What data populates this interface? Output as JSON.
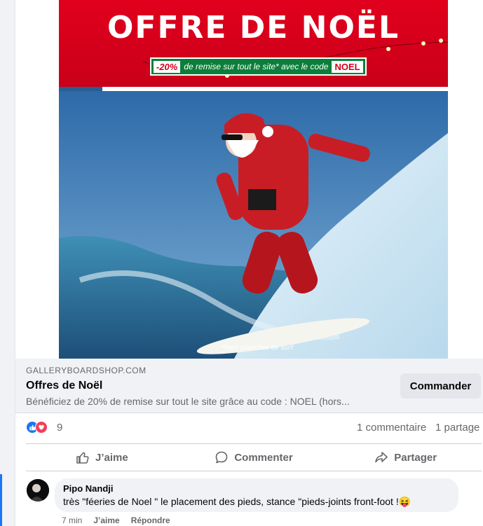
{
  "banner": {
    "title": "OFFRE DE NOËL",
    "discount": "-20%",
    "promo_text": "de remise sur tout le site* avec le code",
    "code": "NOEL",
    "footnote": "*hors planches de surf"
  },
  "link_preview": {
    "domain": "GALLERYBOARDSHOP.COM",
    "title": "Offres de Noël",
    "description": "Bénéficiez de 20% de remise sur tout le site grâce au code : NOEL (hors...",
    "cta_label": "Commander"
  },
  "reactions": {
    "count": "9",
    "comments": "1 commentaire",
    "shares": "1 partage"
  },
  "actions": {
    "like": "J’aime",
    "comment": "Commenter",
    "share": "Partager"
  },
  "comment": {
    "author": "Pipo Nandji",
    "text": "très \"féeries de Noel \" le placement des pieds, stance \"pieds-joints front-foot !😝",
    "time": "7 min",
    "like": "J’aime",
    "reply": "Répondre"
  },
  "colors": {
    "banner_red": "#e1001d",
    "promo_green": "#0b7f3a",
    "facebook_blue": "#1877f2",
    "love_red": "#f33e58"
  }
}
